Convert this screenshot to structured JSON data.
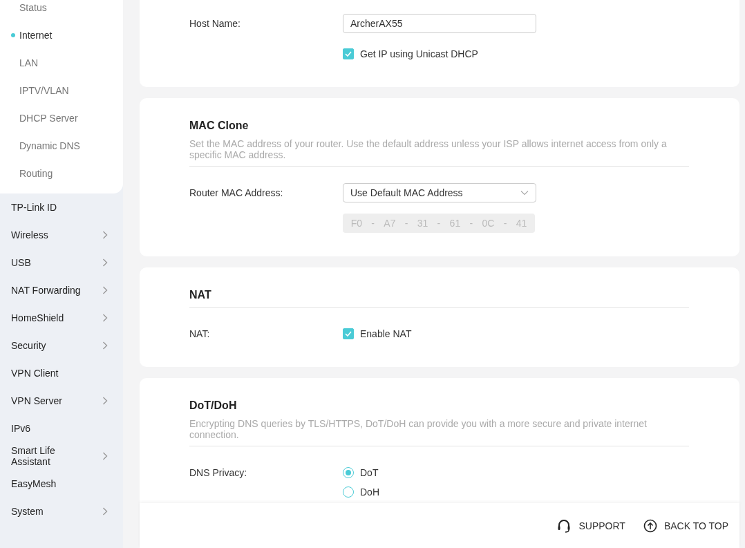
{
  "sidebar": {
    "submenu": [
      {
        "label": "Status",
        "selected": false
      },
      {
        "label": "Internet",
        "selected": true
      },
      {
        "label": "LAN",
        "selected": false
      },
      {
        "label": "IPTV/VLAN",
        "selected": false
      },
      {
        "label": "DHCP Server",
        "selected": false
      },
      {
        "label": "Dynamic DNS",
        "selected": false
      },
      {
        "label": "Routing",
        "selected": false
      }
    ],
    "items": [
      {
        "label": "TP-Link ID",
        "expandable": false
      },
      {
        "label": "Wireless",
        "expandable": true
      },
      {
        "label": "USB",
        "expandable": true
      },
      {
        "label": "NAT Forwarding",
        "expandable": true
      },
      {
        "label": "HomeShield",
        "expandable": true
      },
      {
        "label": "Security",
        "expandable": true
      },
      {
        "label": "VPN Client",
        "expandable": false
      },
      {
        "label": "VPN Server",
        "expandable": true
      },
      {
        "label": "IPv6",
        "expandable": false
      },
      {
        "label": "Smart Life Assistant",
        "expandable": true
      },
      {
        "label": "EasyMesh",
        "expandable": false
      },
      {
        "label": "System",
        "expandable": true
      }
    ]
  },
  "sections": [
    {
      "rows": [
        {
          "kind": "text",
          "label": "Host Name:",
          "value": "ArcherAX55"
        },
        {
          "kind": "checkbox",
          "option": "Get IP using Unicast DHCP",
          "checked": true
        }
      ]
    },
    {
      "title": "MAC Clone",
      "description": "Set the MAC address of your router. Use the default address unless your ISP allows internet access from only a specific MAC address.",
      "rows": [
        {
          "kind": "select",
          "label": "Router MAC Address:",
          "value": "Use Default MAC Address"
        },
        {
          "kind": "mac",
          "octets": [
            "F0",
            "A7",
            "31",
            "61",
            "0C",
            "41"
          ],
          "separator": "-"
        }
      ]
    },
    {
      "title": "NAT",
      "rows": [
        {
          "kind": "checkbox",
          "label": "NAT:",
          "option": "Enable NAT",
          "checked": true
        }
      ]
    },
    {
      "title": "DoT/DoH",
      "description": "Encrypting DNS queries by TLS/HTTPS, DoT/DoH can provide you with a more secure and private internet connection.",
      "rows": [
        {
          "kind": "radio",
          "label": "DNS Privacy:",
          "options": [
            {
              "label": "DoT",
              "selected": true
            },
            {
              "label": "DoH",
              "selected": false
            }
          ]
        }
      ]
    }
  ],
  "footer": {
    "support": "SUPPORT",
    "back_to_top": "BACK TO TOP"
  }
}
